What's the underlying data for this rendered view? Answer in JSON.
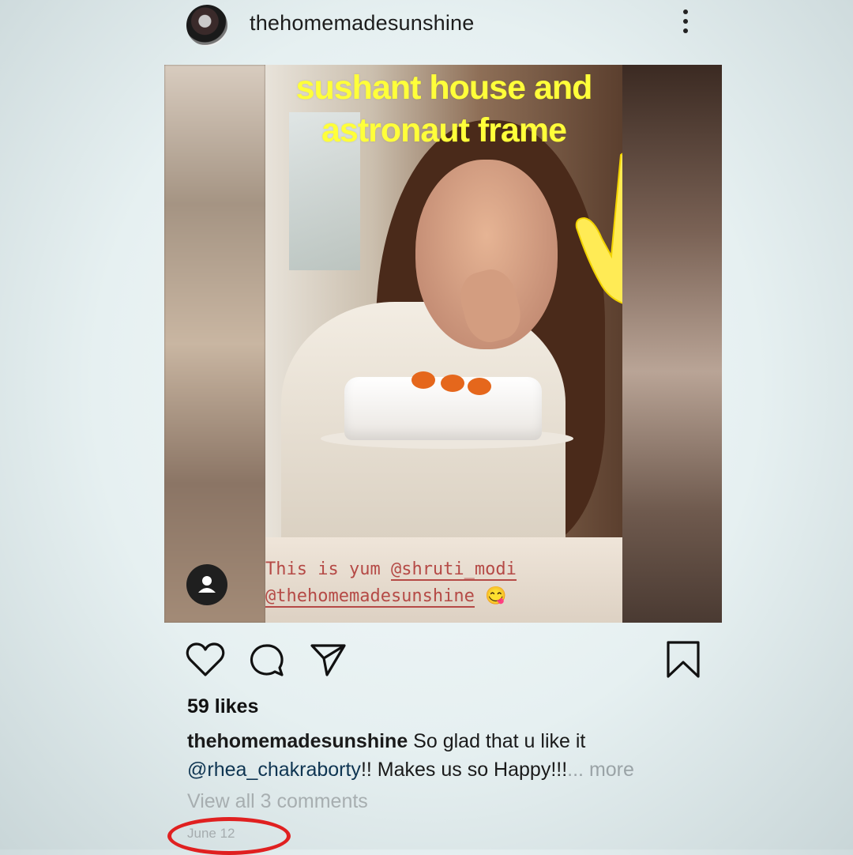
{
  "header": {
    "username": "thehomemadesunshine",
    "avatar_icon": "profile-avatar",
    "menu_icon": "more-vertical-icon"
  },
  "post": {
    "overlay_text_line1": "sushant house and",
    "overlay_text_line2": "astronaut frame",
    "pointer_icon": "pointing-down-hand-emoji",
    "story_caption_line1_text": "This is yum ",
    "story_caption_line1_mention": "@shruti_modi",
    "story_caption_line2_mention": "@thehomemadesunshine",
    "story_caption_emoji": "😋",
    "user_tag_icon": "person-icon"
  },
  "actions": {
    "like_icon": "heart-icon",
    "comment_icon": "comment-bubble-icon",
    "share_icon": "paper-plane-icon",
    "save_icon": "bookmark-icon"
  },
  "meta": {
    "likes": "59 likes",
    "caption_username": "thehomemadesunshine",
    "caption_text_1": " So glad that u like it",
    "caption_mention": "@rhea_chakraborty",
    "caption_text_2": "!! Makes us so Happy!!!",
    "caption_more": "... more",
    "view_comments": "View all 3 comments",
    "date": "June 12"
  },
  "colors": {
    "overlay_text": "#ffff3a",
    "story_caption": "#b54a46",
    "annotation_circle": "#e02020"
  }
}
